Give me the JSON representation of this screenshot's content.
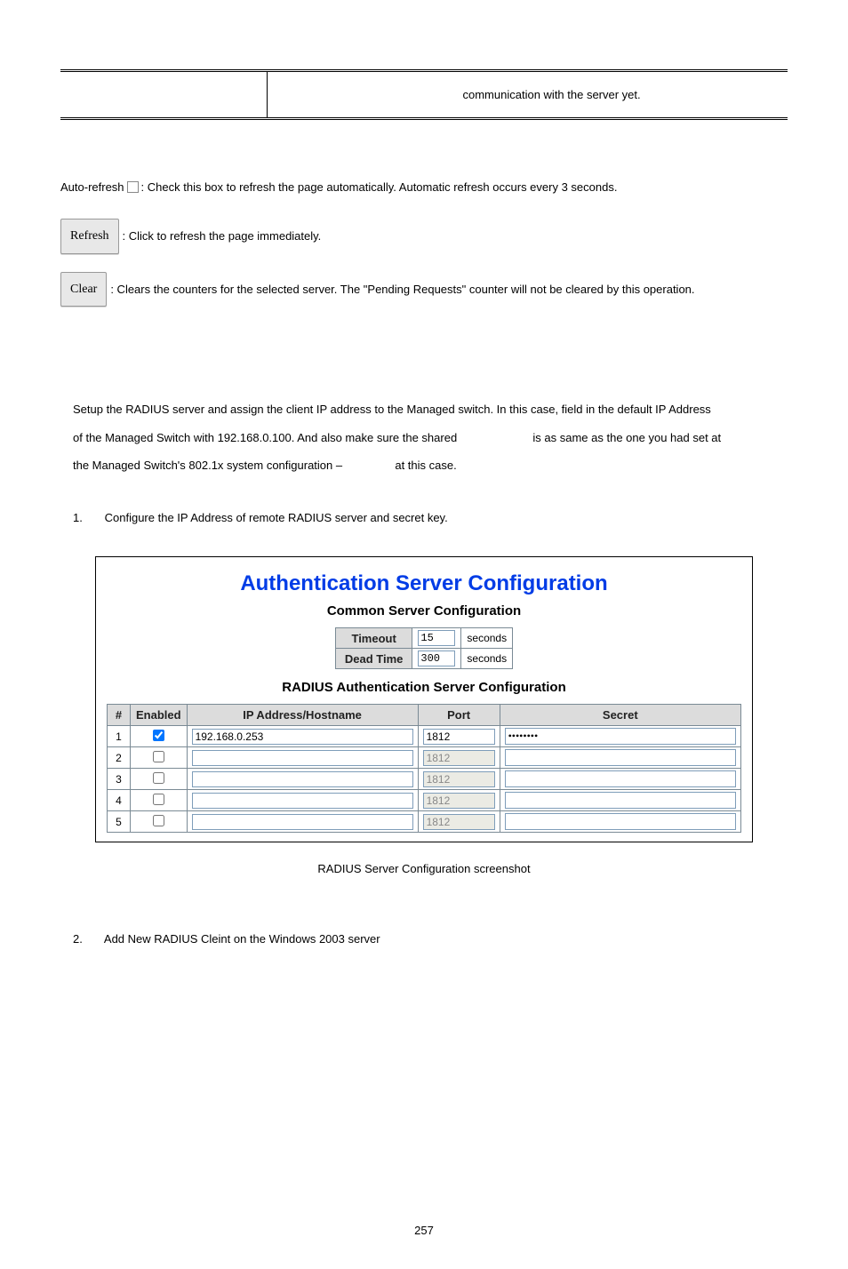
{
  "topTable": {
    "rightCell": "communication with the server yet."
  },
  "buttonsSection": {
    "autoRefresh": {
      "prefix": "Auto-refresh ",
      "suffix": ": Check this box to refresh the page automatically. Automatic refresh occurs every 3 seconds."
    },
    "refresh": {
      "label": "Refresh",
      "desc": ": Click to refresh the page immediately."
    },
    "clear": {
      "label": "Clear",
      "desc": ": Clears the counters for the selected server. The \"Pending Requests\" counter will not be cleared by this operation."
    }
  },
  "setup": {
    "line1a": "Setup the RADIUS server and assign the client IP address to the Managed switch. In this case, field in the default IP Address",
    "line2a": "of the Managed Switch with 192.168.0.100. And also make sure the shared ",
    "line2b": " is as same as the one you had set at",
    "line3a": "the Managed Switch's 802.1x system configuration – ",
    "line3b": " at this case."
  },
  "step1": {
    "num": "1.",
    "text": "Configure the IP Address of remote RADIUS server and secret key."
  },
  "figure": {
    "title": "Authentication Server Configuration",
    "sub1": "Common Server Configuration",
    "common": {
      "timeoutLabel": "Timeout",
      "timeoutValue": "15",
      "deadLabel": "Dead Time",
      "deadValue": "300",
      "unit": "seconds"
    },
    "sub2": "RADIUS Authentication Server Configuration",
    "headers": {
      "num": "#",
      "enabled": "Enabled",
      "host": "IP Address/Hostname",
      "port": "Port",
      "secret": "Secret"
    },
    "rows": [
      {
        "n": "1",
        "enabled": true,
        "host": "192.168.0.253",
        "port": "1812",
        "portDisabled": false,
        "secret": "••••••••"
      },
      {
        "n": "2",
        "enabled": false,
        "host": "",
        "port": "1812",
        "portDisabled": true,
        "secret": ""
      },
      {
        "n": "3",
        "enabled": false,
        "host": "",
        "port": "1812",
        "portDisabled": true,
        "secret": ""
      },
      {
        "n": "4",
        "enabled": false,
        "host": "",
        "port": "1812",
        "portDisabled": true,
        "secret": ""
      },
      {
        "n": "5",
        "enabled": false,
        "host": "",
        "port": "1812",
        "portDisabled": true,
        "secret": ""
      }
    ],
    "caption": "RADIUS Server Configuration screenshot"
  },
  "step2": {
    "num": "2.",
    "text": "Add New RADIUS Cleint on the Windows 2003 server"
  },
  "pageNumber": "257"
}
